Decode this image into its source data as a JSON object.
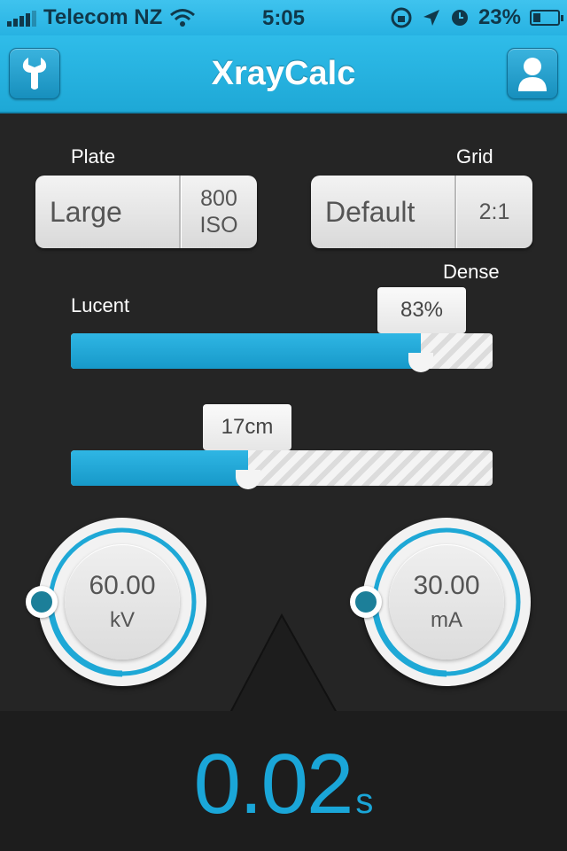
{
  "status": {
    "carrier": "Telecom NZ",
    "time": "5:05",
    "battery": "23%"
  },
  "nav": {
    "title": "XrayCalc",
    "left_icon": "wrench-icon",
    "right_icon": "user-icon"
  },
  "plate": {
    "label": "Plate",
    "size": "Large",
    "iso_value": "800",
    "iso_unit": "ISO"
  },
  "grid": {
    "label": "Grid",
    "type": "Default",
    "ratio": "2:1"
  },
  "density": {
    "left_label": "Lucent",
    "right_label": "Dense",
    "value": "83%",
    "fraction": 0.83
  },
  "thickness": {
    "value": "17cm",
    "fraction": 0.42
  },
  "kv": {
    "value": "60.00",
    "unit": "kV"
  },
  "ma": {
    "value": "30.00",
    "unit": "mA"
  },
  "result": {
    "value": "0.02",
    "unit": "s"
  },
  "colors": {
    "accent": "#1ea8d6",
    "result": "#1aa6d8",
    "background": "#252525"
  }
}
